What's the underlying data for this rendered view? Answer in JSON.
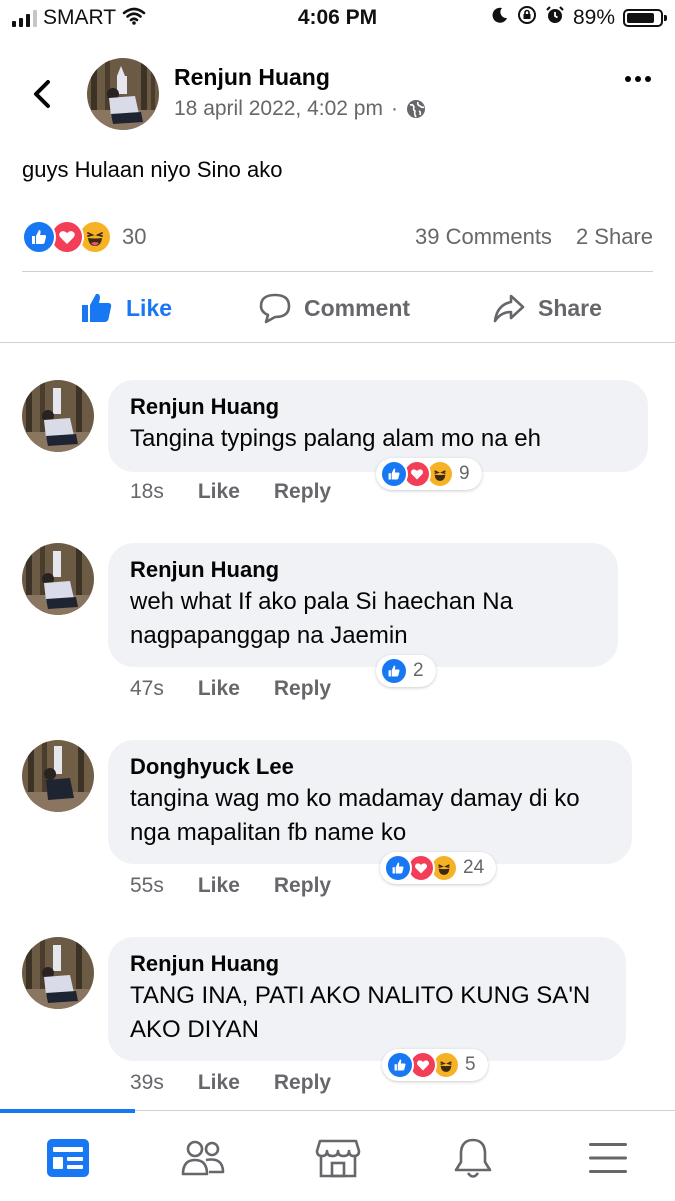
{
  "status_bar": {
    "carrier": "SMART",
    "time": "4:06 PM",
    "battery": "89%",
    "battery_level": 0.89,
    "icons": [
      "signal-icon",
      "wifi-icon",
      "moon-icon",
      "rotation-lock-icon",
      "alarm-icon",
      "battery-icon"
    ]
  },
  "post": {
    "author": "Renjun Huang",
    "timestamp": "18 april 2022, 4:02 pm",
    "separator": "·",
    "privacy_icon": "globe-icon",
    "text": "guys Hulaan niyo Sino ako",
    "reaction_count": "30",
    "reactions": [
      "like",
      "love",
      "haha"
    ],
    "comments_label": "39 Comments",
    "shares_label": "2 Share"
  },
  "actions": {
    "like": "Like",
    "comment": "Comment",
    "share": "Share"
  },
  "comments": [
    {
      "name": "Renjun Huang",
      "text": "Tangina typings palang alam mo na eh",
      "time": "18s",
      "like": "Like",
      "reply": "Reply",
      "reactions": [
        "like",
        "love",
        "haha"
      ],
      "reaction_count": "9"
    },
    {
      "name": "Renjun Huang",
      "text": "weh what If ako pala Si haechan Na nagpapanggap na Jaemin",
      "time": "47s",
      "like": "Like",
      "reply": "Reply",
      "reactions": [
        "like"
      ],
      "reaction_count": "2"
    },
    {
      "name": "Donghyuck Lee",
      "text": "tangina wag mo ko madamay damay di ko nga mapalitan fb name ko",
      "time": "55s",
      "like": "Like",
      "reply": "Reply",
      "reactions": [
        "like",
        "love",
        "haha"
      ],
      "reaction_count": "24"
    },
    {
      "name": "Renjun Huang",
      "text": "TANG INA, PATI AKO NALITO KUNG SA'N AKO DIYAN",
      "time": "39s",
      "like": "Like",
      "reply": "Reply",
      "reactions": [
        "like",
        "love",
        "haha"
      ],
      "reaction_count": "5"
    }
  ],
  "bottom_nav": {
    "items": [
      "news-feed-icon",
      "friends-icon",
      "marketplace-icon",
      "notifications-icon",
      "menu-icon"
    ],
    "active": "news-feed-icon"
  },
  "colors": {
    "accent": "#1877f2",
    "love": "#f33e58",
    "haha": "#f7b125",
    "secondary_text": "#65676b",
    "bubble": "#f0f2f5"
  }
}
